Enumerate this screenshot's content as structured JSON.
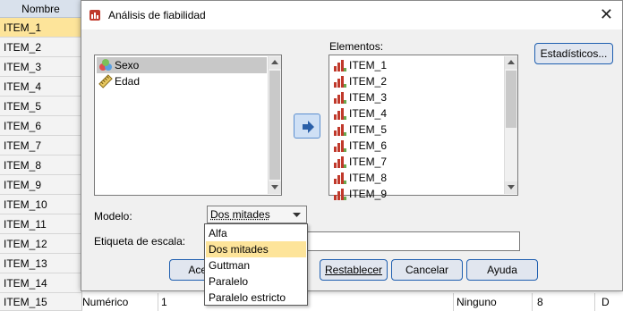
{
  "spreadsheet": {
    "column_header": "Nombre",
    "rows": [
      "ITEM_1",
      "ITEM_2",
      "ITEM_3",
      "ITEM_4",
      "ITEM_5",
      "ITEM_6",
      "ITEM_7",
      "ITEM_8",
      "ITEM_9",
      "ITEM_10",
      "ITEM_11",
      "ITEM_12",
      "ITEM_13",
      "ITEM_14"
    ],
    "last_row": {
      "name": "ITEM_15",
      "type": "Numérico",
      "width": "1",
      "missing": "Ninguno",
      "columns": "8",
      "align": "D"
    }
  },
  "dialog": {
    "title": "Análisis de fiabilidad",
    "close_glyph": "✕",
    "source_list": [
      {
        "label": "Sexo",
        "icon": "nominal-variable-icon"
      },
      {
        "label": "Edad",
        "icon": "scale-variable-icon"
      }
    ],
    "elements_label": "Elementos:",
    "elements": [
      "ITEM_1",
      "ITEM_2",
      "ITEM_3",
      "ITEM_4",
      "ITEM_5",
      "ITEM_6",
      "ITEM_7",
      "ITEM_8",
      "ITEM_9"
    ],
    "stats_button": "Estadísticos...",
    "model_label": "Modelo:",
    "model_value": "Dos mitades",
    "scale_label": "Etiqueta de escala:",
    "scale_value": "",
    "model_options": [
      "Alfa",
      "Dos mitades",
      "Guttman",
      "Paralelo",
      "Paralelo estricto"
    ],
    "buttons": {
      "accept": "Acep",
      "reset": "Restablecer",
      "cancel": "Cancelar",
      "help": "Ayuda"
    }
  },
  "colors": {
    "selection": "#fde49a",
    "button_border": "#1f5fb0",
    "arrow_button": "#cfe0f5"
  }
}
